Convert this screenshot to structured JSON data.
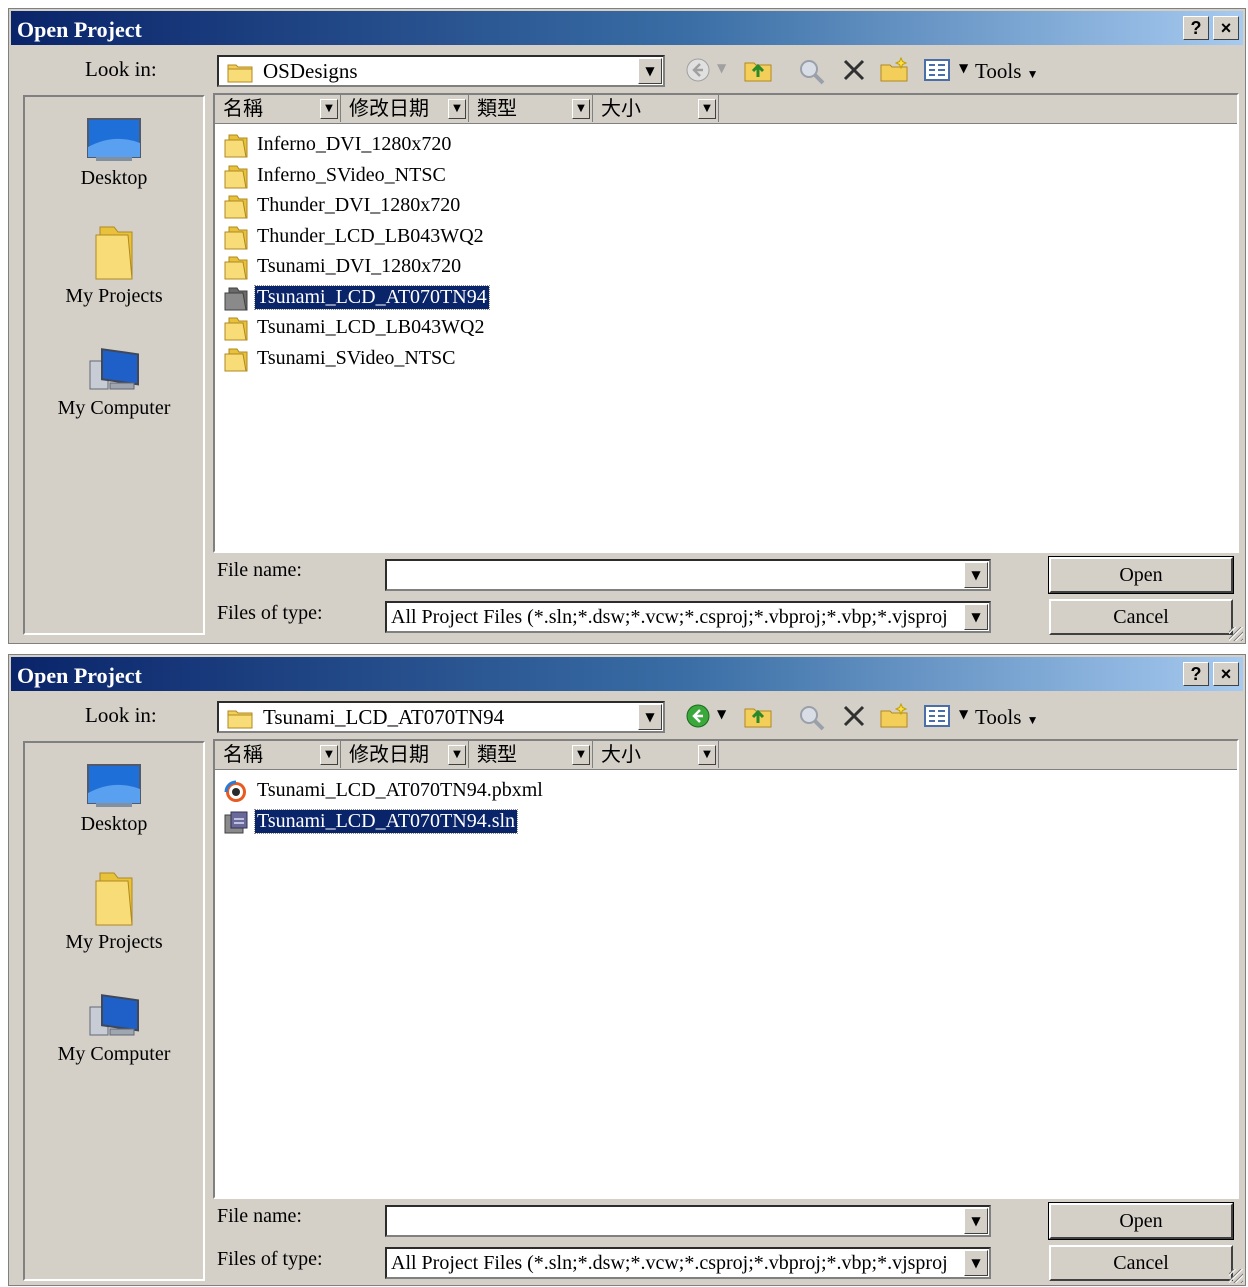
{
  "dialogs": [
    {
      "title": "Open Project",
      "help_button": "?",
      "close_button": "×",
      "look_in_label": "Look in:",
      "look_in_value": "OSDesigns",
      "back_enabled": false,
      "tools_label": "Tools",
      "places": [
        {
          "label": "Desktop",
          "icon": "desktop-icon"
        },
        {
          "label": "My Projects",
          "icon": "folder-icon"
        },
        {
          "label": "My Computer",
          "icon": "computer-icon"
        }
      ],
      "columns": [
        "名稱",
        "修改日期",
        "類型",
        "大小"
      ],
      "files": [
        {
          "name": "Inferno_DVI_1280x720",
          "icon": "folder-icon",
          "selected": false
        },
        {
          "name": "Inferno_SVideo_NTSC",
          "icon": "folder-icon",
          "selected": false
        },
        {
          "name": "Thunder_DVI_1280x720",
          "icon": "folder-icon",
          "selected": false
        },
        {
          "name": "Thunder_LCD_LB043WQ2",
          "icon": "folder-icon",
          "selected": false
        },
        {
          "name": "Tsunami_DVI_1280x720",
          "icon": "folder-icon",
          "selected": false
        },
        {
          "name": "Tsunami_LCD_AT070TN94",
          "icon": "folder-icon",
          "selected": true
        },
        {
          "name": "Tsunami_LCD_LB043WQ2",
          "icon": "folder-icon",
          "selected": false
        },
        {
          "name": "Tsunami_SVideo_NTSC",
          "icon": "folder-icon",
          "selected": false
        }
      ],
      "file_name_label": "File name:",
      "file_name_value": "",
      "files_of_type_label": "Files of type:",
      "files_of_type_value": "All Project Files (*.sln;*.dsw;*.vcw;*.csproj;*.vbproj;*.vbp;*.vjsproj",
      "open_label": "Open",
      "cancel_label": "Cancel"
    },
    {
      "title": "Open Project",
      "help_button": "?",
      "close_button": "×",
      "look_in_label": "Look in:",
      "look_in_value": "Tsunami_LCD_AT070TN94",
      "back_enabled": true,
      "tools_label": "Tools",
      "places": [
        {
          "label": "Desktop",
          "icon": "desktop-icon"
        },
        {
          "label": "My Projects",
          "icon": "folder-icon"
        },
        {
          "label": "My Computer",
          "icon": "computer-icon"
        }
      ],
      "columns": [
        "名稱",
        "修改日期",
        "類型",
        "大小"
      ],
      "files": [
        {
          "name": "Tsunami_LCD_AT070TN94.pbxml",
          "icon": "platform-builder-icon",
          "selected": false
        },
        {
          "name": "Tsunami_LCD_AT070TN94.sln",
          "icon": "solution-file-icon",
          "selected": true
        }
      ],
      "file_name_label": "File name:",
      "file_name_value": "",
      "files_of_type_label": "Files of type:",
      "files_of_type_value": "All Project Files (*.sln;*.dsw;*.vcw;*.csproj;*.vbproj;*.vbp;*.vjsproj",
      "open_label": "Open",
      "cancel_label": "Cancel"
    }
  ],
  "colors": {
    "title_gradient_start": "#0a246a",
    "title_gradient_end": "#a6caf0",
    "selection": "#0a246a",
    "dialog_face": "#d4d0c8"
  }
}
